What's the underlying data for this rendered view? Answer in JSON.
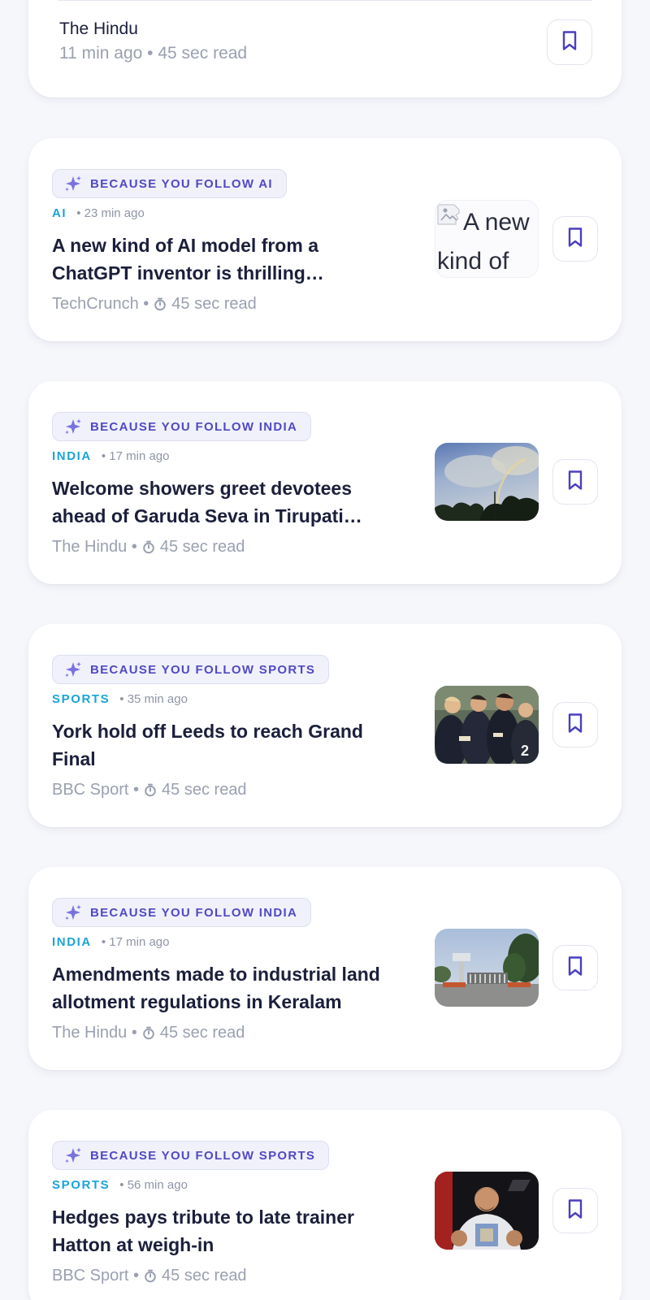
{
  "colors": {
    "background": "#f6f7fb",
    "card": "#ffffff",
    "accent": "#5149c4",
    "category": "#1ba3d8",
    "muted": "#9aa0b0",
    "headline": "#1b1f3b"
  },
  "top_card": {
    "source": "The Hindu",
    "meta": "11 min ago • 45 sec read",
    "bookmark_icon": "bookmark-icon"
  },
  "stories": [
    {
      "reason": "BECAUSE YOU FOLLOW AI",
      "category": "AI",
      "time": "• 23 min ago",
      "headline": "A new kind of AI model from a ChatGPT inventor is thrilling…",
      "source": "TechCrunch •",
      "read": "45 sec read",
      "image_alt": "A new kind of",
      "image_state": "broken"
    },
    {
      "reason": "BECAUSE YOU FOLLOW INDIA",
      "category": "INDIA",
      "time": "• 17 min ago",
      "headline": "Welcome showers greet devotees ahead of Garuda Seva in Tirupati on…",
      "source": "The Hindu •",
      "read": "45 sec read",
      "image_state": "photo-sky-rainbow"
    },
    {
      "reason": "BECAUSE YOU FOLLOW SPORTS",
      "category": "SPORTS",
      "time": "• 35 min ago",
      "headline": "York hold off Leeds to reach Grand Final",
      "source": "BBC Sport •",
      "read": "45 sec read",
      "image_state": "photo-team-celebration"
    },
    {
      "reason": "BECAUSE YOU FOLLOW INDIA",
      "category": "INDIA",
      "time": "• 17 min ago",
      "headline": "Amendments made to industrial land allotment regulations in Keralam",
      "source": "The Hindu •",
      "read": "45 sec read",
      "image_state": "photo-gate-road"
    },
    {
      "reason": "BECAUSE YOU FOLLOW SPORTS",
      "category": "SPORTS",
      "time": "• 56 min ago",
      "headline": "Hedges pays tribute to late trainer Hatton at weigh-in",
      "source": "BBC Sport •",
      "read": "45 sec read",
      "image_state": "photo-boxer"
    }
  ]
}
